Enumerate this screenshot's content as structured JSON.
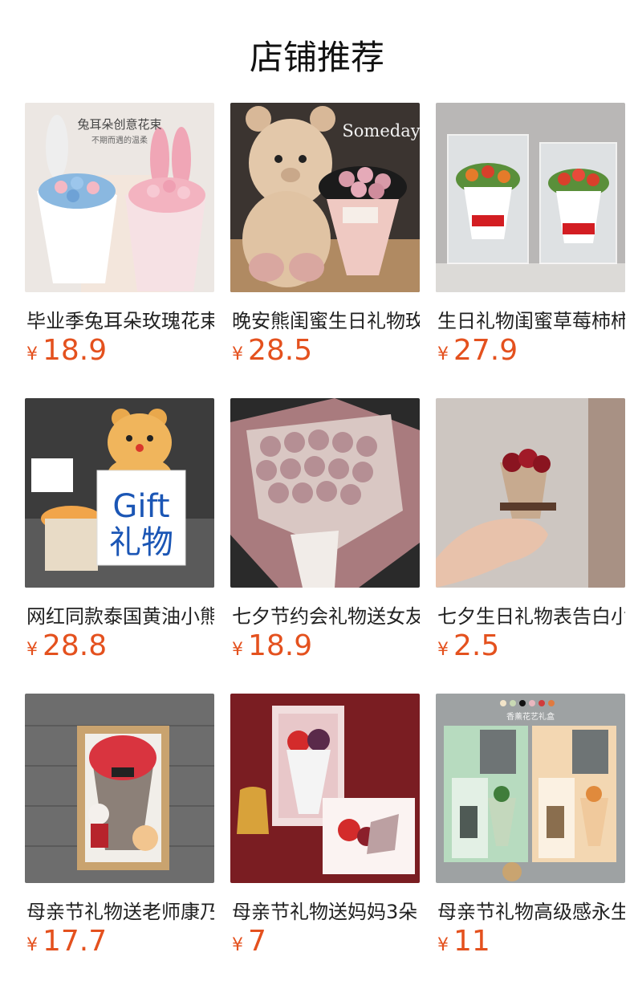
{
  "header": {
    "title": "店铺推荐"
  },
  "products": [
    {
      "name": "毕业季兔耳朵玫瑰花束",
      "currency": "¥",
      "price": "18.9",
      "image_text": [
        "兔耳朵创意花束",
        "不期而遇的温柔"
      ]
    },
    {
      "name": "晚安熊闺蜜生日礼物玫瑰",
      "currency": "¥",
      "price": "28.5",
      "image_text": [
        "Someday"
      ]
    },
    {
      "name": "生日礼物闺蜜草莓柿柿",
      "currency": "¥",
      "price": "27.9",
      "image_text": []
    },
    {
      "name": "网红同款泰国黄油小熊",
      "currency": "¥",
      "price": "28.8",
      "image_text": [
        "Gift",
        "礼物"
      ]
    },
    {
      "name": "七夕节约会礼物送女友",
      "currency": "¥",
      "price": "18.9",
      "image_text": []
    },
    {
      "name": "七夕生日礼物表告白小",
      "currency": "¥",
      "price": "2.5",
      "image_text": []
    },
    {
      "name": "母亲节礼物送老师康乃馨",
      "currency": "¥",
      "price": "17.7",
      "image_text": []
    },
    {
      "name": "母亲节礼物送妈妈3朵",
      "currency": "¥",
      "price": "7",
      "image_text": []
    },
    {
      "name": "母亲节礼物高级感永生",
      "currency": "¥",
      "price": "11",
      "image_text": [
        "香薰花艺礼盒"
      ]
    }
  ]
}
